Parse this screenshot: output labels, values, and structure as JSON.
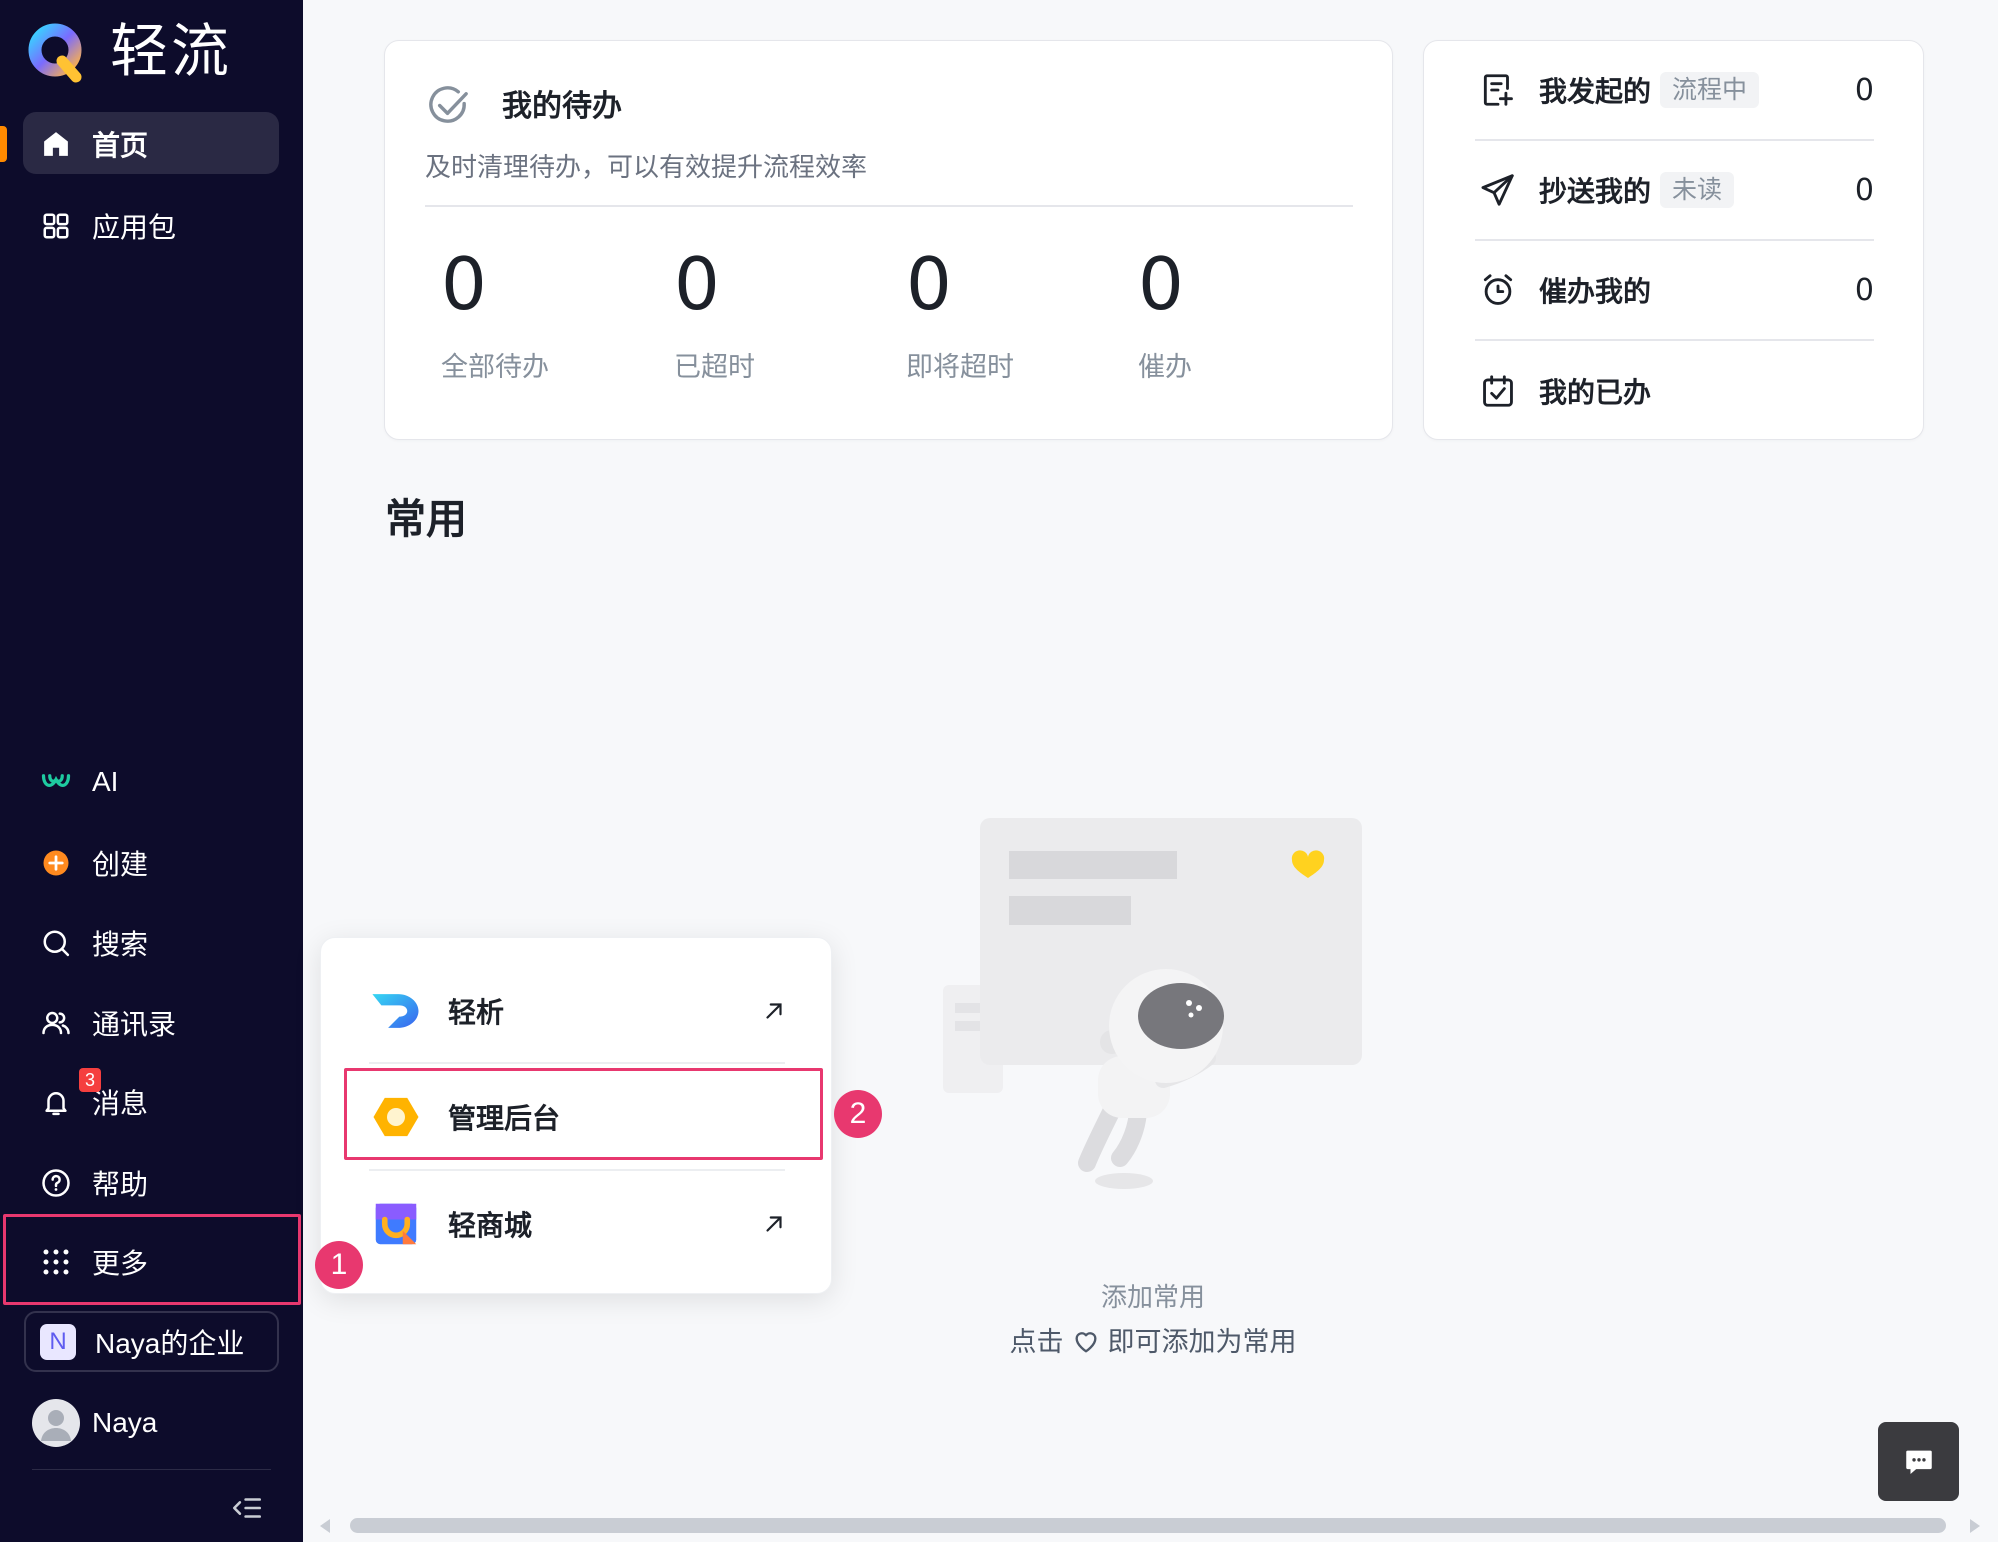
{
  "app": {
    "logo_text": "轻流",
    "logo_icon": "qingliu-logo-icon"
  },
  "sidebar": {
    "top_items": [
      {
        "label": "首页",
        "icon": "home-icon",
        "active": true
      },
      {
        "label": "应用包",
        "icon": "grid-icon",
        "active": false
      }
    ],
    "bottom_items": [
      {
        "label": "AI",
        "icon": "ai-icon"
      },
      {
        "label": "创建",
        "icon": "create-icon"
      },
      {
        "label": "搜索",
        "icon": "search-icon"
      },
      {
        "label": "通讯录",
        "icon": "contacts-icon"
      },
      {
        "label": "消息",
        "icon": "bell-icon",
        "badge": "3"
      },
      {
        "label": "帮助",
        "icon": "help-icon"
      },
      {
        "label": "更多",
        "icon": "more-grid-icon"
      }
    ],
    "workspace": {
      "initial": "N",
      "name": "Naya的企业"
    },
    "user": {
      "name": "Naya"
    }
  },
  "todo_card": {
    "title": "我的待办",
    "subtitle": "及时清理待办，可以有效提升流程效率",
    "stats": [
      {
        "value": "0",
        "label": "全部待办"
      },
      {
        "value": "0",
        "label": "已超时"
      },
      {
        "value": "0",
        "label": "即将超时"
      },
      {
        "value": "0",
        "label": "催办"
      }
    ]
  },
  "summary_card": {
    "rows": [
      {
        "label": "我发起的",
        "badge": "流程中",
        "count": "0",
        "icon": "doc-plus-icon"
      },
      {
        "label": "抄送我的",
        "badge": "未读",
        "count": "0",
        "icon": "send-icon"
      },
      {
        "label": "催办我的",
        "count": "0",
        "icon": "alarm-clock-icon"
      },
      {
        "label": "我的已办",
        "icon": "calendar-check-icon"
      }
    ]
  },
  "common": {
    "title": "常用",
    "empty_title": "添加常用",
    "empty_hint_prefix": "点击",
    "empty_hint_icon": "heart-outline-icon",
    "empty_hint_suffix": "即可添加为常用"
  },
  "more_menu": {
    "items": [
      {
        "label": "轻析",
        "icon": "qingxi-logo-icon",
        "trailing_icon": "arrow-up-right-icon"
      },
      {
        "label": "管理后台",
        "icon": "admin-hexagon-icon"
      },
      {
        "label": "轻商城",
        "icon": "mall-bag-icon",
        "trailing_icon": "arrow-up-right-icon"
      }
    ]
  },
  "annotations": {
    "step1": "1",
    "step2": "2"
  },
  "colors": {
    "sidebar_bg": "#0d0c2b",
    "active_indicator": "#ff8a00",
    "highlight_border": "#e8386f",
    "notification_red": "#f53f3f",
    "page_bg": "#f7f8fa"
  }
}
